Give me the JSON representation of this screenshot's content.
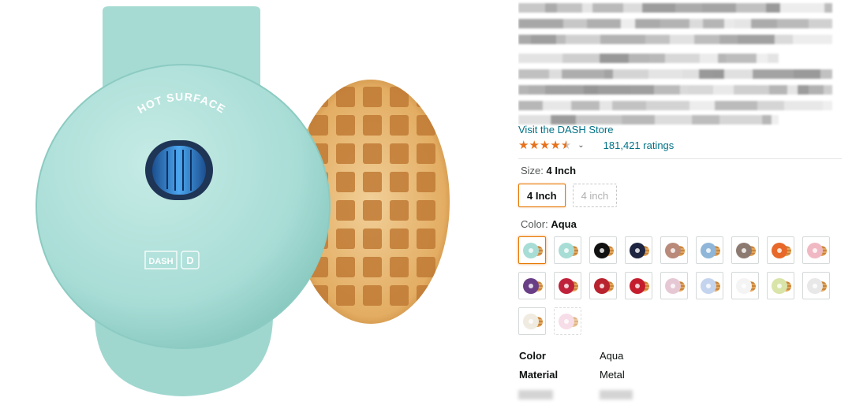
{
  "product": {
    "store_link": "Visit the DASH Store",
    "rating_value": 4.7,
    "rating_count": "181,421 ratings",
    "image": {
      "lid_text": "HOT SURFACE",
      "brand_mark": "DASH",
      "colors": {
        "body": "#a8ddd6",
        "body_shadow": "#8fcfc6",
        "light": "#2a78c9",
        "waffle": "#e1a45c"
      }
    }
  },
  "size": {
    "label": "Size:",
    "selected": "4 Inch",
    "options": [
      {
        "label": "4 Inch",
        "state": "selected"
      },
      {
        "label": "4 inch",
        "state": "unavailable"
      }
    ]
  },
  "color": {
    "label": "Color:",
    "selected": "Aqua",
    "swatches": [
      {
        "color": "#a8ddd6",
        "state": "selected"
      },
      {
        "color": "#a8ddd6",
        "state": "available"
      },
      {
        "color": "#111111",
        "state": "available"
      },
      {
        "color": "#1d2540",
        "state": "available"
      },
      {
        "color": "#b98a7a",
        "state": "available"
      },
      {
        "color": "#8fb6d8",
        "state": "available"
      },
      {
        "color": "#8c7a70",
        "state": "available"
      },
      {
        "color": "#e8682a",
        "state": "available"
      },
      {
        "color": "#f0b8c2",
        "state": "available"
      },
      {
        "color": "#6a3e86",
        "state": "available"
      },
      {
        "color": "#c0213a",
        "state": "available"
      },
      {
        "color": "#b8232f",
        "state": "available"
      },
      {
        "color": "#c41e2e",
        "state": "available"
      },
      {
        "color": "#e6c8d4",
        "state": "available"
      },
      {
        "color": "#c4d4ee",
        "state": "available"
      },
      {
        "color": "#f4f4f4",
        "state": "available"
      },
      {
        "color": "#d8e4a8",
        "state": "available"
      },
      {
        "color": "#e8e8e8",
        "state": "available"
      },
      {
        "color": "#f0ebe0",
        "state": "available"
      },
      {
        "color": "#f2c8d8",
        "state": "unavailable"
      }
    ]
  },
  "specs": [
    {
      "key": "Color",
      "value": "Aqua"
    },
    {
      "key": "Material",
      "value": "Metal"
    }
  ]
}
